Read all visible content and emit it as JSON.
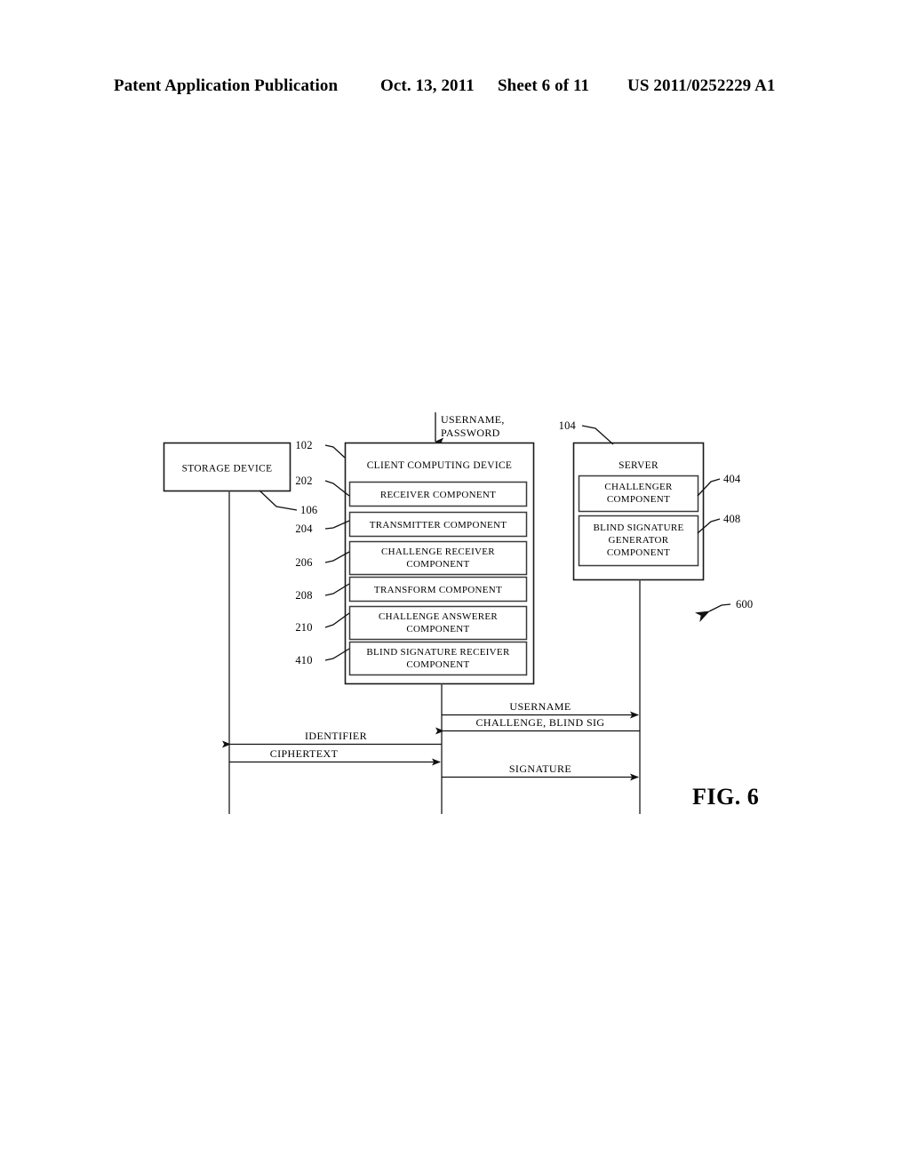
{
  "header": {
    "publication": "Patent Application Publication",
    "date": "Oct. 13, 2011",
    "sheet": "Sheet 6 of 11",
    "number": "US 2011/0252229 A1"
  },
  "figure": {
    "label": "FIG. 6",
    "diagram_ref": "600",
    "input_arrow": {
      "line1": "USERNAME,",
      "line2": "PASSWORD"
    },
    "nodes": [
      {
        "id": "storage-device",
        "title": "STORAGE DEVICE",
        "ref": "106",
        "components": []
      },
      {
        "id": "client-computing-device",
        "title": "CLIENT COMPUTING DEVICE",
        "ref": "102",
        "components": [
          {
            "label": "RECEIVER COMPONENT",
            "ref": "202"
          },
          {
            "label": "TRANSMITTER COMPONENT",
            "ref": "204"
          },
          {
            "label": "CHALLENGE RECEIVER COMPONENT",
            "ref": "206"
          },
          {
            "label": "TRANSFORM COMPONENT",
            "ref": "208"
          },
          {
            "label": "CHALLENGE ANSWERER COMPONENT",
            "ref": "210"
          },
          {
            "label": "BLIND SIGNATURE RECEIVER COMPONENT",
            "ref": "410"
          }
        ]
      },
      {
        "id": "server",
        "title": "SERVER",
        "ref": "104",
        "components": [
          {
            "label": "CHALLENGER COMPONENT",
            "ref": "404"
          },
          {
            "label": "BLIND SIGNATURE GENERATOR COMPONENT",
            "ref": "408"
          }
        ]
      }
    ],
    "messages": [
      {
        "id": "msg-username",
        "label": "USERNAME",
        "from": "client",
        "to": "server",
        "direction": "right"
      },
      {
        "id": "msg-challenge",
        "label": "CHALLENGE, BLIND SIG",
        "from": "server",
        "to": "client",
        "direction": "left"
      },
      {
        "id": "msg-identifier",
        "label": "IDENTIFIER",
        "from": "client",
        "to": "storage",
        "direction": "left"
      },
      {
        "id": "msg-ciphertext",
        "label": "CIPHERTEXT",
        "from": "storage",
        "to": "client",
        "direction": "right"
      },
      {
        "id": "msg-signature",
        "label": "SIGNATURE",
        "from": "client",
        "to": "server",
        "direction": "right"
      }
    ]
  }
}
